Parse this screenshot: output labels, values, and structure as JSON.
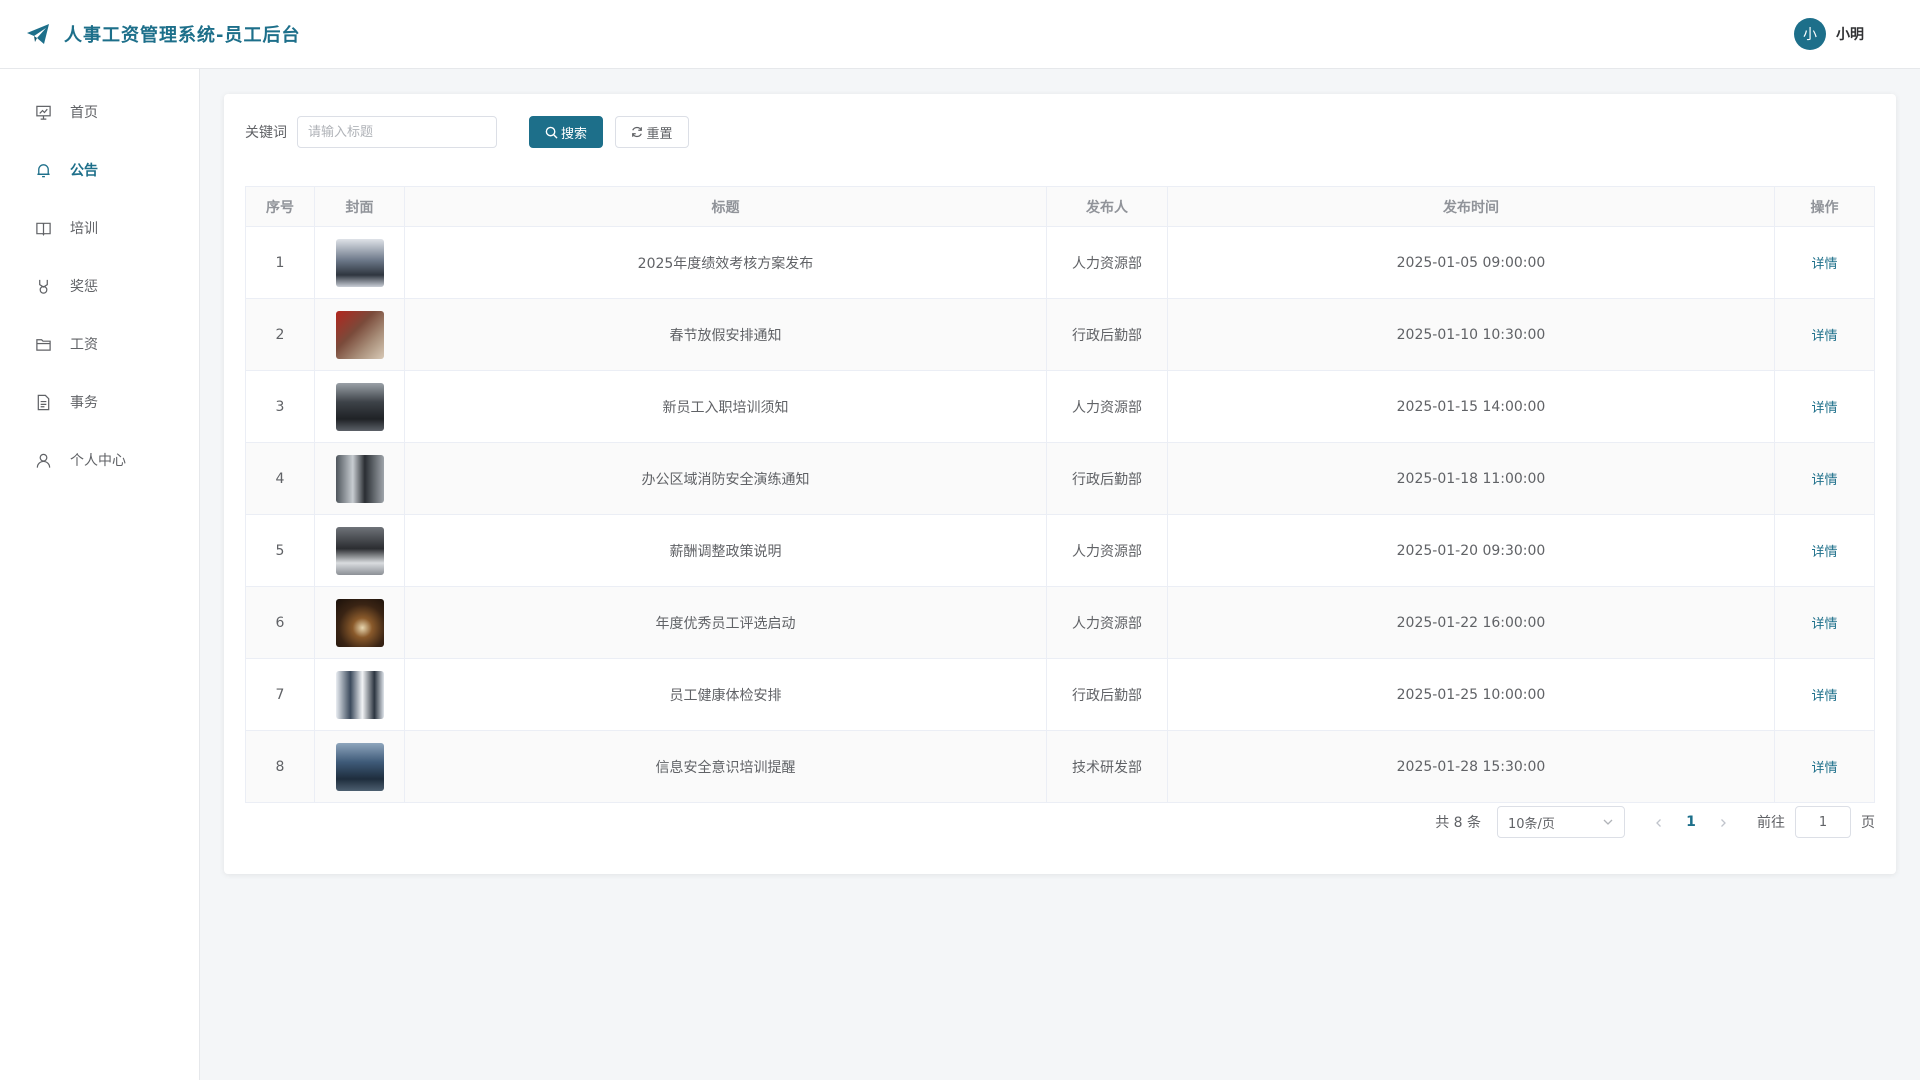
{
  "app": {
    "title": "人事工资管理系统-员工后台"
  },
  "user": {
    "avatar_text": "小",
    "name": "小明"
  },
  "sidebar": {
    "items": [
      {
        "label": "首页",
        "icon": "presentation-icon"
      },
      {
        "label": "公告",
        "icon": "bell-icon",
        "active": true
      },
      {
        "label": "培训",
        "icon": "book-icon"
      },
      {
        "label": "奖惩",
        "icon": "medal-icon"
      },
      {
        "label": "工资",
        "icon": "wallet-icon"
      },
      {
        "label": "事务",
        "icon": "document-icon"
      },
      {
        "label": "个人中心",
        "icon": "user-icon"
      }
    ]
  },
  "search": {
    "label": "关键词",
    "placeholder": "请输入标题",
    "search_button": "搜索",
    "reset_button": "重置"
  },
  "table": {
    "headers": [
      "序号",
      "封面",
      "标题",
      "发布人",
      "发布时间",
      "操作"
    ],
    "rows": [
      {
        "index": "1",
        "title": "2025年度绩效考核方案发布",
        "publisher": "人力资源部",
        "time": "2025-01-05 09:00:00",
        "action": "详情"
      },
      {
        "index": "2",
        "title": "春节放假安排通知",
        "publisher": "行政后勤部",
        "time": "2025-01-10 10:30:00",
        "action": "详情"
      },
      {
        "index": "3",
        "title": "新员工入职培训须知",
        "publisher": "人力资源部",
        "time": "2025-01-15 14:00:00",
        "action": "详情"
      },
      {
        "index": "4",
        "title": "办公区域消防安全演练通知",
        "publisher": "行政后勤部",
        "time": "2025-01-18 11:00:00",
        "action": "详情"
      },
      {
        "index": "5",
        "title": "薪酬调整政策说明",
        "publisher": "人力资源部",
        "time": "2025-01-20 09:30:00",
        "action": "详情"
      },
      {
        "index": "6",
        "title": "年度优秀员工评选启动",
        "publisher": "人力资源部",
        "time": "2025-01-22 16:00:00",
        "action": "详情"
      },
      {
        "index": "7",
        "title": "员工健康体检安排",
        "publisher": "行政后勤部",
        "time": "2025-01-25 10:00:00",
        "action": "详情"
      },
      {
        "index": "8",
        "title": "信息安全意识培训提醒",
        "publisher": "技术研发部",
        "time": "2025-01-28 15:30:00",
        "action": "详情"
      }
    ]
  },
  "pagination": {
    "total_text": "共 8 条",
    "page_size": "10条/页",
    "current_page": "1",
    "goto_prefix": "前往",
    "goto_value": "1",
    "goto_suffix": "页"
  },
  "colors": {
    "accent": "#1d6f8a"
  }
}
